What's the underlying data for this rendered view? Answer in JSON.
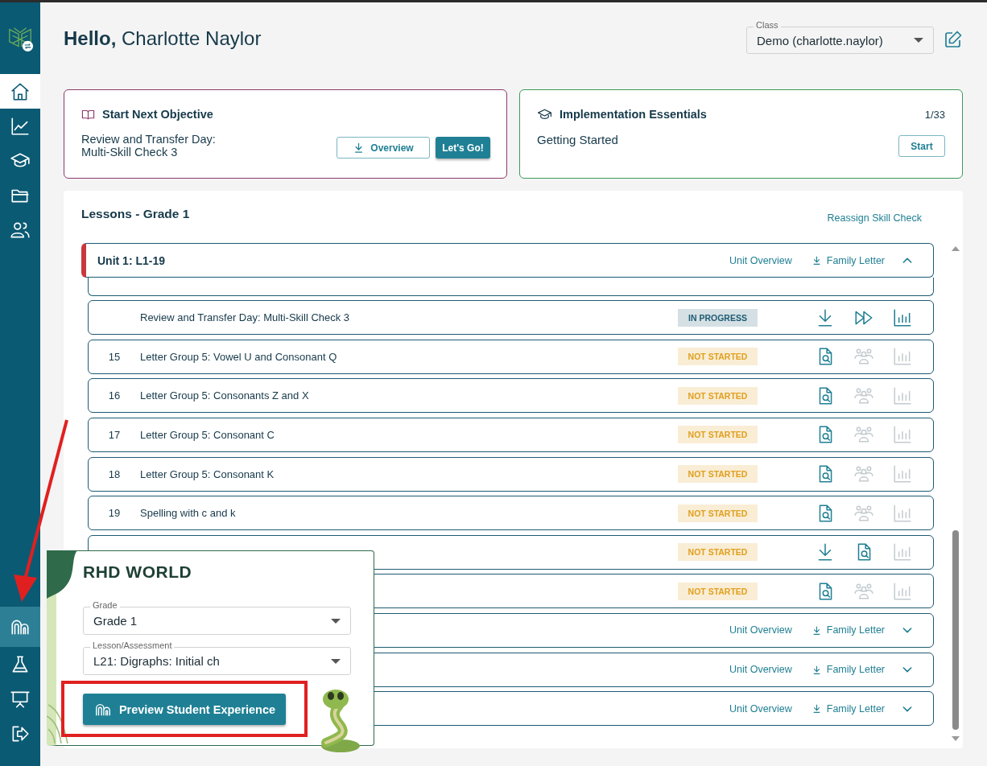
{
  "sidebar": {
    "items": [
      {
        "kind": "home",
        "selected": true,
        "open": false
      },
      {
        "kind": "progress",
        "selected": false,
        "open": false
      },
      {
        "kind": "training",
        "selected": false,
        "open": false
      },
      {
        "kind": "files",
        "selected": false,
        "open": false
      },
      {
        "kind": "students",
        "selected": false,
        "open": false
      },
      {
        "kind": "world",
        "selected": false,
        "open": true
      },
      {
        "kind": "lab",
        "selected": false,
        "open": false
      },
      {
        "kind": "present",
        "selected": false,
        "open": false
      },
      {
        "kind": "logout",
        "selected": false,
        "open": false
      }
    ]
  },
  "greeting": {
    "hello": "Hello,",
    "name": "Charlotte Naylor"
  },
  "class_select": {
    "label": "Class",
    "value": "Demo (charlotte.naylor)"
  },
  "next_objective": {
    "title": "Start Next Objective",
    "text": "Review and Transfer Day: Multi-Skill Check 3",
    "overview_button": "Overview",
    "go_button": "Let's Go!"
  },
  "implementation": {
    "title": "Implementation Essentials",
    "count": "1/33",
    "text": "Getting Started",
    "button": "Start"
  },
  "lessons": {
    "title": "Lessons - Grade 1",
    "reassign_link": "Reassign Skill Check",
    "items": [
      {
        "kind": "unit",
        "title": "Unit 1: L1-19",
        "current": true,
        "expanded": true,
        "overview": "Unit Overview",
        "family_letter": "Family Letter"
      },
      {
        "kind": "lesson_hidden"
      },
      {
        "kind": "lesson",
        "title": "Review and Transfer Day: Multi-Skill Check 3",
        "status": "IN PROGRESS",
        "color": "#1d5a72",
        "icons": [
          {
            "kind": "download",
            "enabled": true
          },
          {
            "kind": "skip",
            "enabled": true
          },
          {
            "kind": "chart",
            "enabled": true
          }
        ]
      },
      {
        "kind": "lesson",
        "number": "15",
        "title": "Letter Group 5: Vowel U and Consonant Q",
        "status": "NOT STARTED",
        "color": "#e0a020",
        "icons": [
          {
            "kind": "preview",
            "enabled": true
          },
          {
            "kind": "group",
            "enabled": false
          },
          {
            "kind": "chart",
            "enabled": false
          }
        ]
      },
      {
        "kind": "lesson",
        "number": "16",
        "title": "Letter Group 5: Consonants Z and X",
        "status": "NOT STARTED",
        "color": "#e0a020",
        "icons": [
          {
            "kind": "preview",
            "enabled": true
          },
          {
            "kind": "group",
            "enabled": false
          },
          {
            "kind": "chart",
            "enabled": false
          }
        ]
      },
      {
        "kind": "lesson",
        "number": "17",
        "title": "Letter Group 5: Consonant C",
        "status": "NOT STARTED",
        "color": "#e0a020",
        "icons": [
          {
            "kind": "preview",
            "enabled": true
          },
          {
            "kind": "group",
            "enabled": false
          },
          {
            "kind": "chart",
            "enabled": false
          }
        ]
      },
      {
        "kind": "lesson",
        "number": "18",
        "title": "Letter Group 5: Consonant K",
        "status": "NOT STARTED",
        "color": "#e0a020",
        "icons": [
          {
            "kind": "preview",
            "enabled": true
          },
          {
            "kind": "group",
            "enabled": false
          },
          {
            "kind": "chart",
            "enabled": false
          }
        ]
      },
      {
        "kind": "lesson",
        "number": "19",
        "title": "Spelling with c and k",
        "status": "NOT STARTED",
        "color": "#e0a020",
        "icons": [
          {
            "kind": "preview",
            "enabled": true
          },
          {
            "kind": "group",
            "enabled": false
          },
          {
            "kind": "chart",
            "enabled": false
          }
        ]
      },
      {
        "kind": "lesson",
        "status": "NOT STARTED",
        "color": "#e0a020",
        "icons": [
          {
            "kind": "download",
            "enabled": true
          },
          {
            "kind": "preview",
            "enabled": true
          },
          {
            "kind": "chart",
            "enabled": false
          }
        ]
      },
      {
        "kind": "lesson",
        "status": "NOT STARTED",
        "color": "#e0a020",
        "icons": [
          {
            "kind": "preview",
            "enabled": true
          },
          {
            "kind": "group",
            "enabled": false
          },
          {
            "kind": "chart",
            "enabled": false
          }
        ]
      },
      {
        "kind": "unit",
        "current": false,
        "expanded": false,
        "overview": "Unit Overview",
        "family_letter": "Family Letter"
      },
      {
        "kind": "unit",
        "current": false,
        "expanded": false,
        "overview": "Unit Overview",
        "family_letter": "Family Letter"
      },
      {
        "kind": "unit",
        "current": false,
        "expanded": false,
        "overview": "Unit Overview",
        "family_letter": "Family Letter"
      }
    ]
  },
  "rhd_world": {
    "title": "RHD WORLD",
    "grade": {
      "label": "Grade",
      "value": "Grade 1"
    },
    "lesson": {
      "label": "Lesson/Assessment",
      "value": "L21: Digraphs: Initial ch"
    },
    "button": "Preview Student Experience"
  }
}
